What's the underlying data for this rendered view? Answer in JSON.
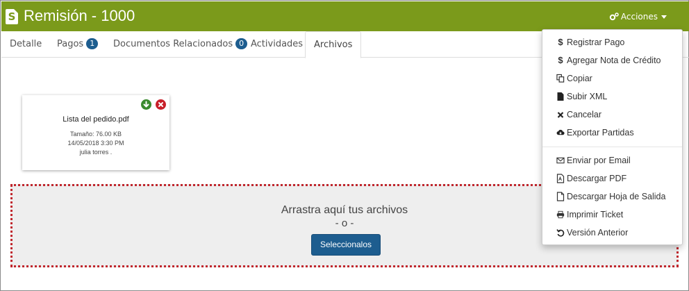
{
  "header": {
    "logo_letter": "S",
    "title": "Remisión - 1000",
    "actions_label": "Acciones"
  },
  "tabs": [
    {
      "label": "Detalle"
    },
    {
      "label": "Pagos",
      "badge": "1"
    },
    {
      "label": "Documentos Relacionados",
      "badge": "0"
    },
    {
      "label": "Actividades"
    },
    {
      "label": "Archivos",
      "active": true
    }
  ],
  "file": {
    "name": "Lista del pedido.pdf",
    "size": "Tamaño: 76.00 KB",
    "date": "14/05/2018 3:30 PM",
    "user": "julia torres ."
  },
  "dropzone": {
    "text": "Arrastra aquí tus archivos",
    "or": "- o -",
    "button": "Seleccionalos"
  },
  "menu": {
    "group1": [
      {
        "icon": "dollar-icon",
        "label": "Registrar Pago"
      },
      {
        "icon": "dollar-icon",
        "label": "Agregar Nota de Crédito"
      },
      {
        "icon": "copy-icon",
        "label": "Copiar"
      },
      {
        "icon": "file-icon",
        "label": "Subir XML"
      },
      {
        "icon": "x-icon",
        "label": "Cancelar"
      },
      {
        "icon": "cloud-download-icon",
        "label": "Exportar Partidas"
      }
    ],
    "group2": [
      {
        "icon": "envelope-icon",
        "label": "Enviar por Email"
      },
      {
        "icon": "pdf-icon",
        "label": "Descargar PDF"
      },
      {
        "icon": "file-outline-icon",
        "label": "Descargar Hoja de Salida"
      },
      {
        "icon": "print-icon",
        "label": "Imprimir Ticket"
      },
      {
        "icon": "undo-icon",
        "label": "Versión Anterior"
      }
    ]
  },
  "colors": {
    "header_green": "#7b9a1b",
    "primary_blue": "#1d5d8f",
    "download_green": "#3a8a2e",
    "delete_red": "#c8202a",
    "dropzone_border": "#c0272d"
  }
}
